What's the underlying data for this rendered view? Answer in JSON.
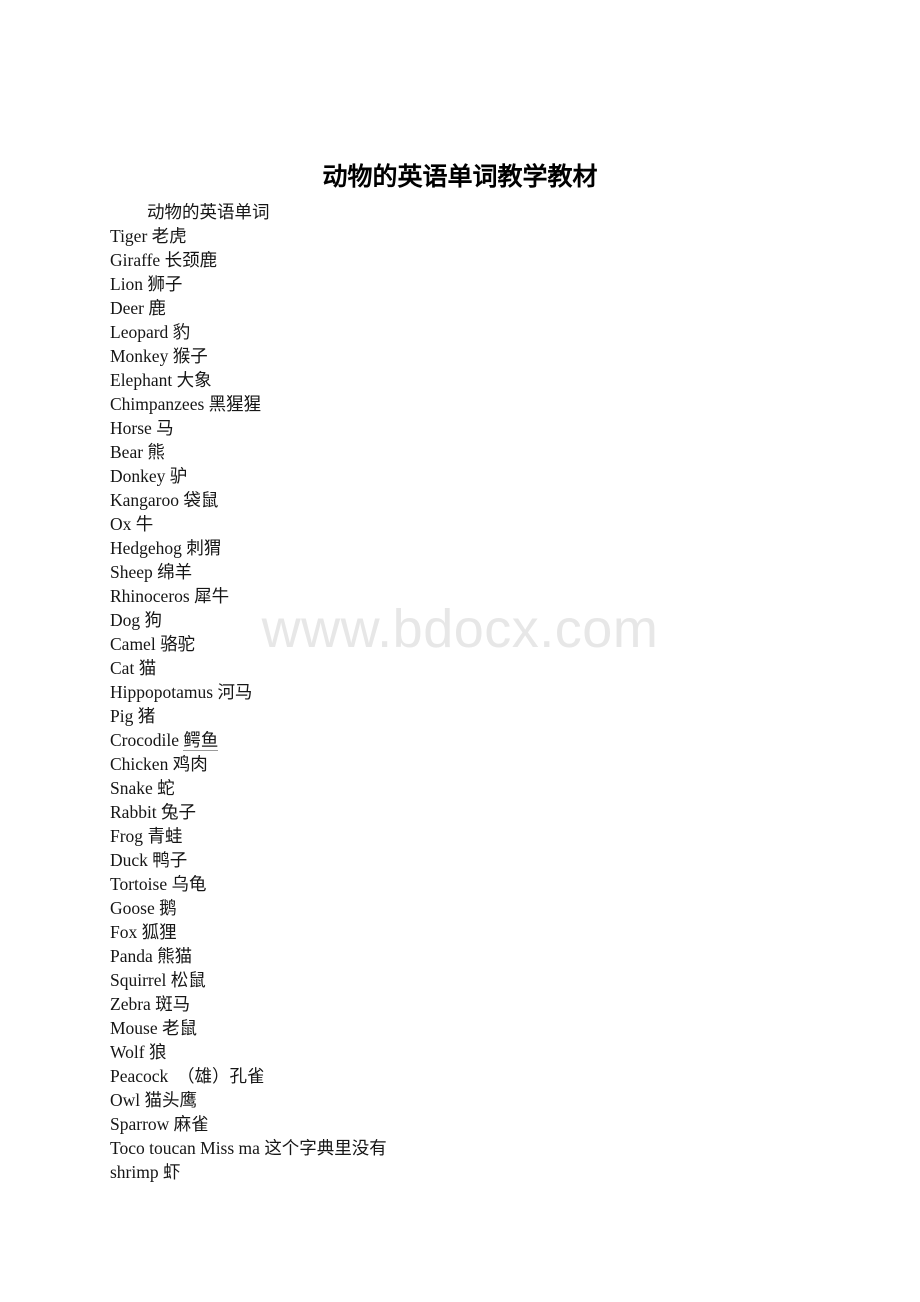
{
  "document": {
    "title": "动物的英语单词教学教材",
    "watermark": "www.bdocx.com",
    "heading_line": "动物的英语单词",
    "entries": [
      {
        "english": "Tiger",
        "chinese": "老虎"
      },
      {
        "english": "Giraffe",
        "chinese": "长颈鹿"
      },
      {
        "english": "Lion",
        "chinese": "狮子"
      },
      {
        "english": "Deer",
        "chinese": "鹿"
      },
      {
        "english": "Leopard",
        "chinese": "豹"
      },
      {
        "english": "Monkey",
        "chinese": "猴子"
      },
      {
        "english": "Elephant",
        "chinese": "大象"
      },
      {
        "english": "Chimpanzees",
        "chinese": "黑猩猩"
      },
      {
        "english": "Horse",
        "chinese": "马"
      },
      {
        "english": "Bear",
        "chinese": "熊"
      },
      {
        "english": "Donkey",
        "chinese": "驴"
      },
      {
        "english": "Kangaroo",
        "chinese": "袋鼠"
      },
      {
        "english": "Ox",
        "chinese": "牛"
      },
      {
        "english": "Hedgehog",
        "chinese": "刺猬"
      },
      {
        "english": "Sheep",
        "chinese": "绵羊"
      },
      {
        "english": "Rhinoceros",
        "chinese": "犀牛"
      },
      {
        "english": "Dog",
        "chinese": "狗"
      },
      {
        "english": "Camel",
        "chinese": "骆驼"
      },
      {
        "english": "Cat",
        "chinese": "猫"
      },
      {
        "english": "Hippopotamus",
        "chinese": "河马"
      },
      {
        "english": "Pig",
        "chinese": "猪"
      },
      {
        "english": "Crocodile",
        "chinese": "鳄鱼",
        "underline": true
      },
      {
        "english": "Chicken",
        "chinese": "鸡肉"
      },
      {
        "english": "Snake",
        "chinese": "蛇"
      },
      {
        "english": "Rabbit",
        "chinese": "兔子"
      },
      {
        "english": "Frog",
        "chinese": "青蛙"
      },
      {
        "english": "Duck",
        "chinese": "鸭子"
      },
      {
        "english": "Tortoise",
        "chinese": "乌龟"
      },
      {
        "english": "Goose",
        "chinese": "鹅"
      },
      {
        "english": "Fox",
        "chinese": "狐狸"
      },
      {
        "english": "Panda",
        "chinese": "熊猫"
      },
      {
        "english": "Squirrel",
        "chinese": "松鼠"
      },
      {
        "english": "Zebra",
        "chinese": "斑马"
      },
      {
        "english": "Mouse",
        "chinese": "老鼠"
      },
      {
        "english": "Wolf",
        "chinese": "狼"
      },
      {
        "english": "Peacock",
        "chinese": " （雄）孔雀"
      },
      {
        "english": "Owl",
        "chinese": "猫头鹰"
      },
      {
        "english": "Sparrow",
        "chinese": "麻雀"
      },
      {
        "english": "Toco toucan Miss ma",
        "chinese": "这个字典里没有"
      },
      {
        "english": "shrimp",
        "chinese": "虾"
      }
    ]
  }
}
